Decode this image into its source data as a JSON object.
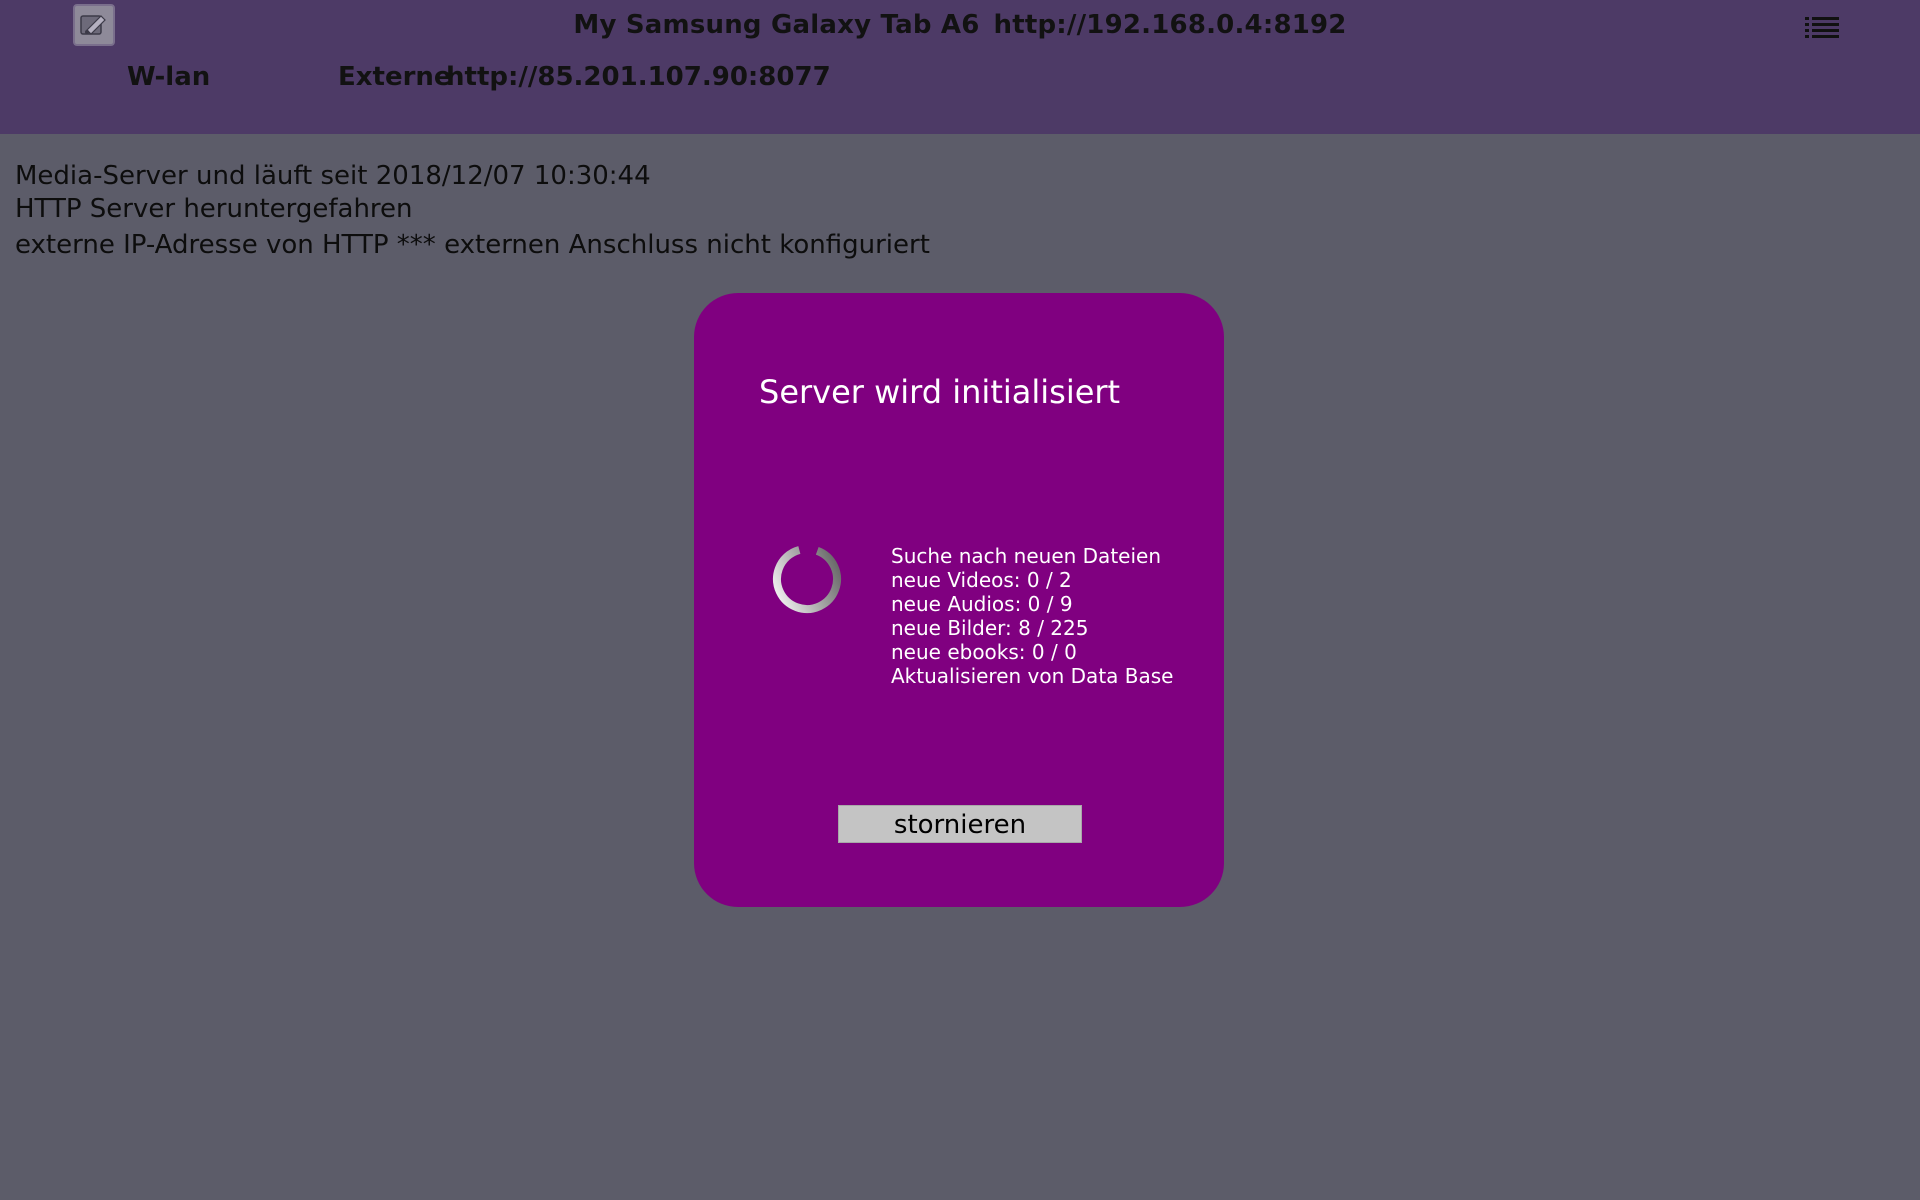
{
  "header": {
    "device_name": "My Samsung Galaxy Tab A6",
    "local_url": "http://192.168.0.4:8192",
    "wlan_label": "W-lan",
    "externe_label": "Externe",
    "externe_url": "http://85.201.107.90:8077",
    "app_icon": "app-icon",
    "menu_icon": "list-menu-icon"
  },
  "status": {
    "line1": "Media-Server und läuft seit 2018/12/07 10:30:44",
    "line2": "HTTP Server heruntergefahren",
    "line3": "externe IP-Adresse von HTTP *** externen Anschluss nicht konfiguriert"
  },
  "dialog": {
    "title": "Server wird initialisiert",
    "progress_lines": [
      "Suche nach neuen Dateien",
      "neue Videos: 0 / 2",
      "neue Audios: 0 / 9",
      "neue Bilder: 8 / 225",
      "neue ebooks: 0 / 0",
      "Aktualisieren von Data Base"
    ],
    "cancel_label": "stornieren",
    "spinner_icon": "loading-spinner-icon"
  },
  "colors": {
    "header_bg": "#4d3a66",
    "page_bg": "#5c5c69",
    "dialog_bg": "#800080",
    "button_bg": "#c4c4c4"
  }
}
